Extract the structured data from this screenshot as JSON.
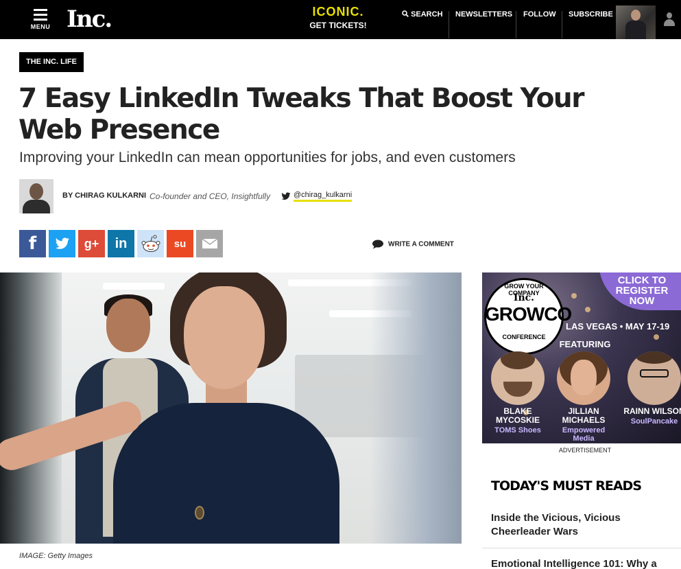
{
  "nav": {
    "menu_label": "MENU",
    "logo": "Inc.",
    "promo_brand": "ICONIC.",
    "promo_cta": "GET TICKETS!",
    "search": "SEARCH",
    "newsletters": "NEWSLETTERS",
    "follow": "FOLLOW",
    "subscribe": "SUBSCRIBE"
  },
  "article": {
    "category": "THE INC. LIFE",
    "headline": "7 Easy LinkedIn Tweaks That Boost Your Web Presence",
    "dek": "Improving your LinkedIn can mean opportunities for jobs, and even customers",
    "byline": "BY CHIRAG KULKARNI",
    "author_title": "Co-founder and CEO, Insightfully",
    "twitter_handle": "@chirag_kulkarni",
    "write_comment": "WRITE A COMMENT",
    "image_caption": "IMAGE: Getty Images"
  },
  "share": {
    "facebook": "f",
    "googleplus": "g+",
    "linkedin": "in",
    "stumbleupon": "su"
  },
  "ad": {
    "cta": "CLICK TO REGISTER NOW",
    "seal_top": "GROW YOUR COMPANY",
    "seal_brand": "Inc.",
    "seal_name": "GROWCO",
    "seal_bottom": "CONFERENCE",
    "where": "LAS VEGAS • MAY 17-19",
    "featuring": "FEATURING",
    "speakers": [
      {
        "name": "BLAKE MYCOSKIE",
        "company": "TOMS Shoes"
      },
      {
        "name": "JILLIAN MICHAELS",
        "company": "Empowered Media"
      },
      {
        "name": "RAINN WILSON",
        "company": "SoulPancake"
      }
    ],
    "label": "ADVERTISEMENT"
  },
  "must_reads": {
    "heading": "TODAY'S MUST READS",
    "items": [
      "Inside the Vicious, Vicious Cheerleader Wars",
      "Emotional Intelligence 101: Why a"
    ]
  },
  "colors": {
    "accent_yellow": "#e8e000",
    "facebook": "#3b5998",
    "twitter": "#1da1f2",
    "googleplus": "#dd4b39",
    "linkedin": "#0e76a8",
    "stumbleupon": "#eb4924",
    "ad_purple": "#8b6ad6"
  }
}
